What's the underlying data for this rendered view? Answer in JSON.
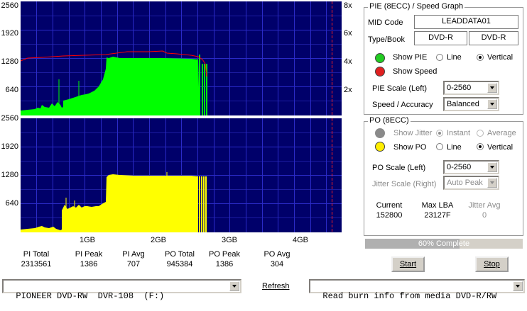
{
  "graph_top": {
    "y_ticks": [
      "2560",
      "1920",
      "1280",
      "640"
    ],
    "speed_ticks": [
      "8x",
      "6x",
      "4x",
      "2x"
    ],
    "fill_color": "#00ff00",
    "speed_color": "#ff0000"
  },
  "graph_bottom": {
    "y_ticks": [
      "2560",
      "1920",
      "1280",
      "640"
    ],
    "fill_color": "#ffff00"
  },
  "x_ticks": [
    "1GB",
    "2GB",
    "3GB",
    "4GB"
  ],
  "stats": [
    {
      "label": "PI Total",
      "value": "2313561"
    },
    {
      "label": "PI Peak",
      "value": "1386"
    },
    {
      "label": "PI Avg",
      "value": "707"
    },
    {
      "label": "PO Total",
      "value": "945384"
    },
    {
      "label": "PO Peak",
      "value": "1386"
    },
    {
      "label": "PO Avg",
      "value": "304"
    }
  ],
  "pie_group": {
    "title": "PIE (8ECC) / Speed Graph",
    "mid_label": "MID Code",
    "mid_value": "LEADDATA01",
    "type_label": "Type/Book",
    "type_value": "DVD-R",
    "book_value": "DVD-R",
    "show_pie": "Show PIE",
    "line": "Line",
    "vertical": "Vertical",
    "show_speed": "Show Speed",
    "pie_scale_label": "PIE Scale (Left)",
    "pie_scale_value": "0-2560",
    "speed_label": "Speed / Accuracy",
    "speed_value": "Balanced"
  },
  "po_group": {
    "title": "PO (8ECC)",
    "show_jitter": "Show Jitter",
    "instant": "Instant",
    "average": "Average",
    "show_po": "Show PO",
    "line": "Line",
    "vertical": "Vertical",
    "po_scale_label": "PO Scale (Left)",
    "po_scale_value": "0-2560",
    "jitter_scale_label": "Jitter Scale (Right)",
    "jitter_scale_value": "Auto Peak",
    "current_label": "Current",
    "current_value": "152800",
    "maxlba_label": "Max LBA",
    "maxlba_value": "23127F",
    "jitter_avg_label": "Jitter Avg",
    "jitter_avg_value": "0"
  },
  "progress": {
    "text": "60% Complete",
    "fraction": 0.6
  },
  "buttons": {
    "start": "Start",
    "stop": "Stop",
    "refresh": "Refresh"
  },
  "drive": {
    "value": "PIONEER DVD-RW  DVR-108  (F:)"
  },
  "mode": {
    "value": "Read burn info from media DVD-R/RW"
  }
}
